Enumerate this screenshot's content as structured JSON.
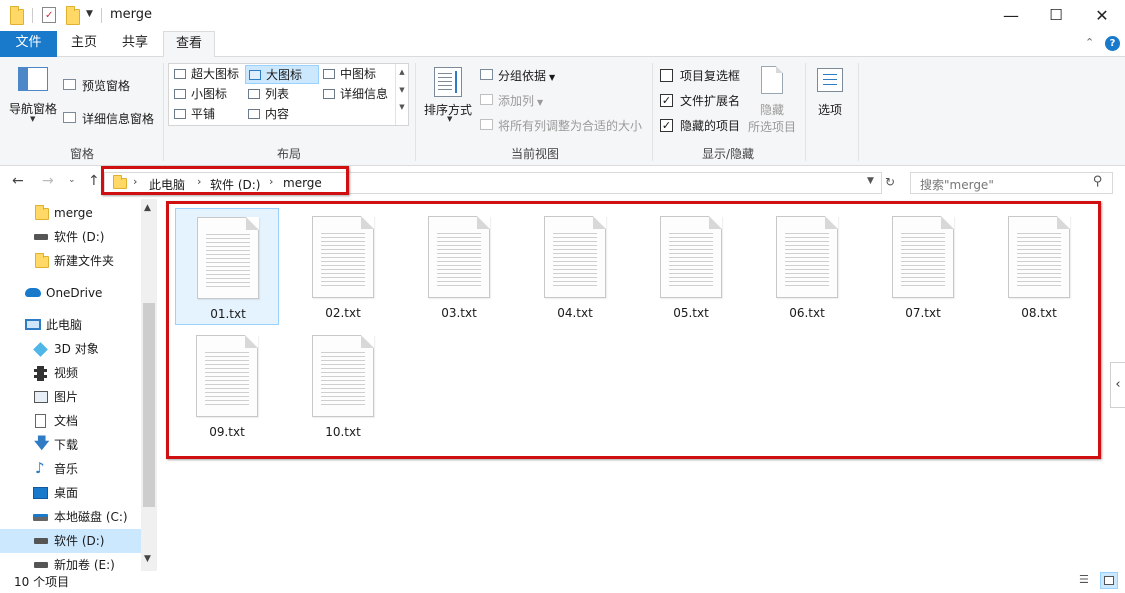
{
  "titlebar": {
    "title": "merge",
    "minimize": "—",
    "maximize": "☐",
    "close": "✕"
  },
  "tabs": {
    "file": "文件",
    "home": "主页",
    "share": "共享",
    "view": "查看"
  },
  "ribbon": {
    "panes": {
      "label": "窗格",
      "nav_pane": "导航窗格",
      "preview_pane": "预览窗格",
      "details_pane": "详细信息窗格"
    },
    "layout": {
      "label": "布局",
      "items": [
        "超大图标",
        "大图标",
        "中图标",
        "小图标",
        "列表",
        "详细信息",
        "平铺",
        "内容"
      ],
      "selected": "大图标"
    },
    "current_view": {
      "label": "当前视图",
      "sort_by": "排序方式",
      "group_by": "分组依据",
      "add_column": "添加列",
      "fit_columns": "将所有列调整为合适的大小"
    },
    "show_hide": {
      "label": "显示/隐藏",
      "item_checkboxes": "项目复选框",
      "file_extensions": "文件扩展名",
      "hidden_items": "隐藏的项目",
      "hide_selected_1": "隐藏",
      "hide_selected_2": "所选项目",
      "item_checkboxes_checked": false,
      "file_extensions_checked": true,
      "hidden_items_checked": true
    },
    "options": "选项"
  },
  "address": {
    "crumbs": [
      "此电脑",
      "软件 (D:)",
      "merge"
    ],
    "search_placeholder": "搜索\"merge\""
  },
  "sidebar": {
    "items": [
      "merge",
      "软件 (D:)",
      "新建文件夹",
      "OneDrive",
      "此电脑",
      "3D 对象",
      "视频",
      "图片",
      "文档",
      "下载",
      "音乐",
      "桌面",
      "本地磁盘 (C:)",
      "软件 (D:)",
      "新加卷 (E:)"
    ],
    "selected_index": 13
  },
  "files": [
    "01.txt",
    "02.txt",
    "03.txt",
    "04.txt",
    "05.txt",
    "06.txt",
    "07.txt",
    "08.txt",
    "09.txt",
    "10.txt"
  ],
  "status": {
    "count": "10 个项目"
  },
  "colors": {
    "accent": "#1979ca",
    "highlight": "#d01010",
    "selection": "#cce8ff"
  }
}
